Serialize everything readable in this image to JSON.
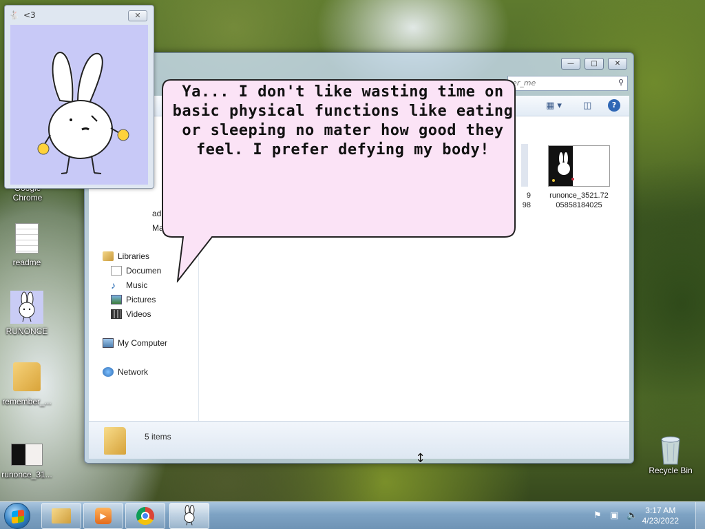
{
  "desktop": {
    "icons": [
      {
        "label": "Google Chrome"
      },
      {
        "label": "readme"
      },
      {
        "label": "RUNONCE"
      },
      {
        "label": "remember_..."
      },
      {
        "label": "runonce_31..."
      },
      {
        "label": "Recycle Bin"
      }
    ]
  },
  "pet_window": {
    "title": "<3"
  },
  "explorer": {
    "search_placeholder": "er_me",
    "nav": {
      "libraries": "Libraries",
      "documents": "Documen",
      "music": "Music",
      "pictures": "Pictures",
      "videos": "Videos",
      "my_computer": "My Computer",
      "network": "Network",
      "partial_1": "ad",
      "partial_2": "Ma"
    },
    "files": [
      {
        "name_line1": "9",
        "name_line2": "98"
      },
      {
        "name_line1": "runonce_3521.72",
        "name_line2": "05858184025"
      }
    ],
    "status": "5 items"
  },
  "speech_bubble": {
    "text": "Ya... I don't like wasting time on basic physical functions like eating or sleeping no mater how good they feel. I prefer defying my body!"
  },
  "taskbar": {
    "clock_time": "3:17 AM",
    "clock_date": "4/23/2022"
  }
}
